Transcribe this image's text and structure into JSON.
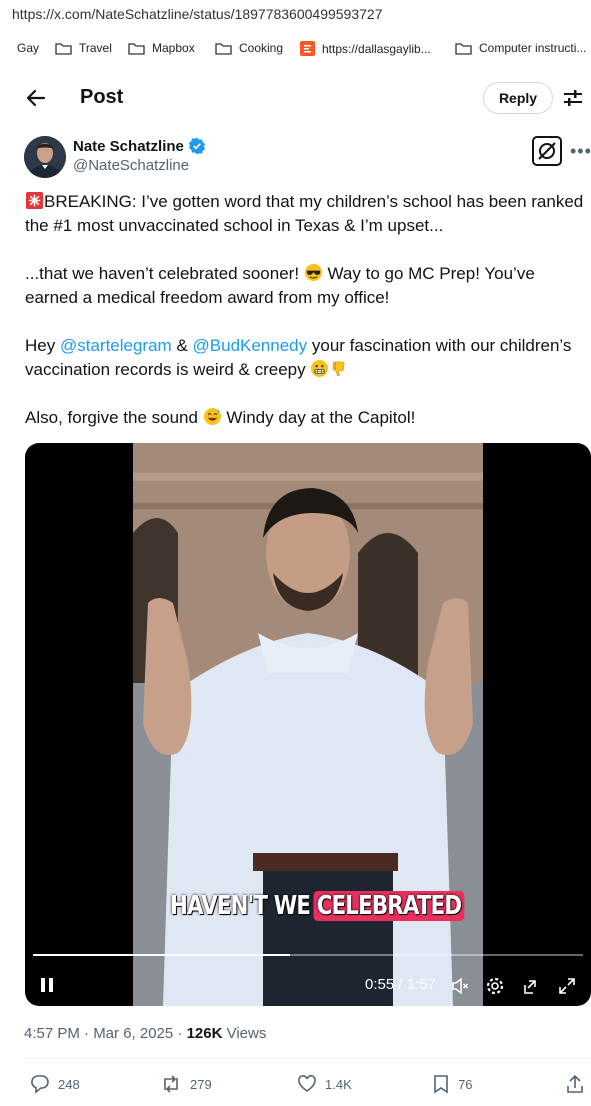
{
  "browser": {
    "url": "https://x.com/NateSchatzline/status/1897783600499593727",
    "bookmarks": [
      "Gay",
      "Travel",
      "Mapbox",
      "Cooking",
      "https://dallasgaylib...",
      "Computer instructi..."
    ]
  },
  "header": {
    "title": "Post",
    "reply_label": "Reply"
  },
  "author": {
    "name": "Nate Schatzline",
    "handle": "@NateSchatzline"
  },
  "tweet": {
    "p1": "BREAKING: I’ve gotten word that my children’s school has been ranked the #1 most unvaccinated school in Texas & I’m upset...",
    "p2a": "...that we haven’t celebrated sooner! ",
    "p2b": " Way to go MC Prep! You’ve earned a medical freedom award from my office!",
    "p3a": "Hey ",
    "mention1": "@startelegram",
    "p3b": " & ",
    "mention2": "@BudKennedy",
    "p3c": " your fascination with our children’s vaccination records is weird & creepy ",
    "p4a": "Also, forgive the sound ",
    "p4b": " Windy day at the Capitol!"
  },
  "video": {
    "caption_plain": "HAVEN'T WE",
    "caption_highlight": "CELEBRATED",
    "time": "0:55 / 1:57",
    "progress": 0.467
  },
  "meta": {
    "time": "4:57 PM · Mar 6, 2025 · ",
    "views": "126K",
    "views_label": " Views"
  },
  "actions": {
    "replies": "248",
    "reposts": "279",
    "likes": "1.4K",
    "bookmarks": "76"
  },
  "colors": {
    "link": "#1d9bf0",
    "verified": "#1d9bf0",
    "caption_highlight": "#e8305e"
  }
}
